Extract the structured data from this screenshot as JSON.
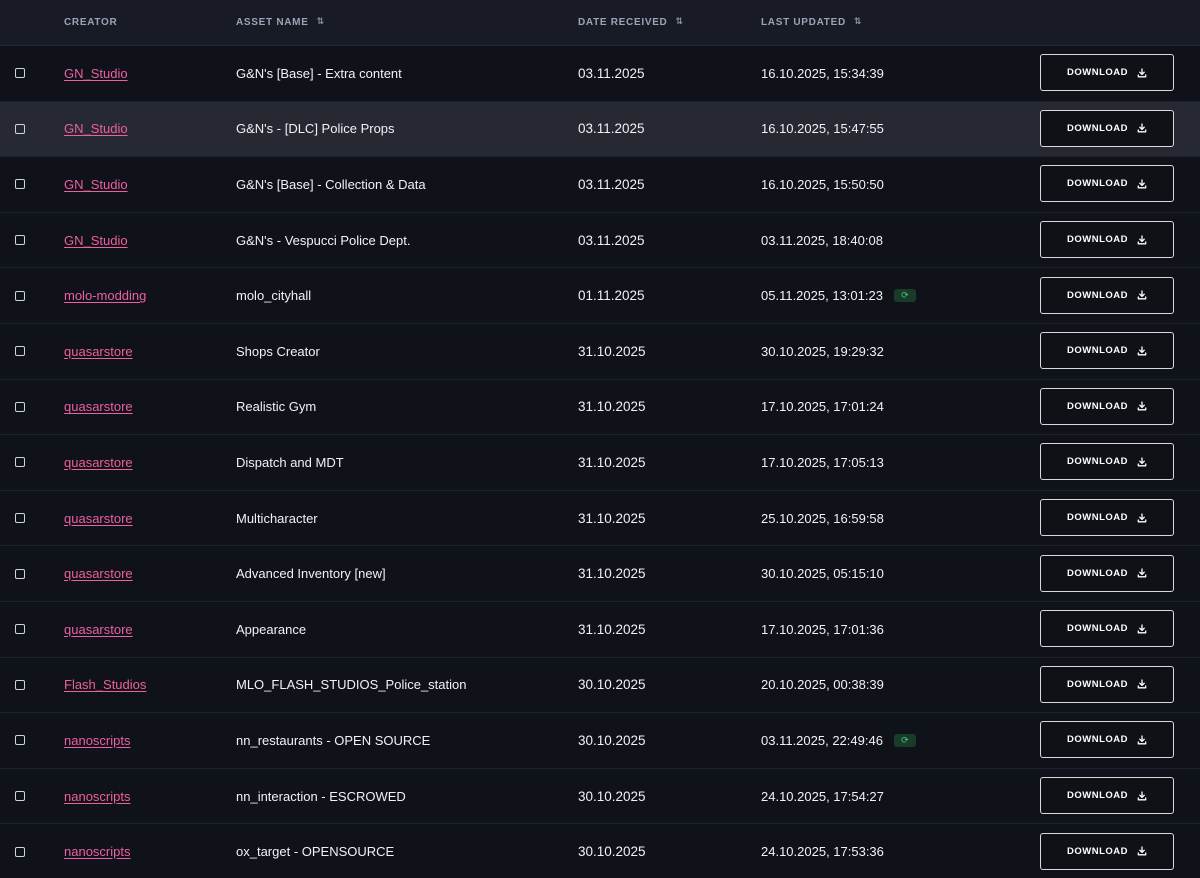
{
  "header": {
    "creator": "CREATOR",
    "asset_name": "ASSET NAME",
    "date_received": "DATE RECEIVED",
    "last_updated": "LAST UPDATED",
    "sort_glyph": "⇅"
  },
  "button": {
    "download_label": "DOWNLOAD"
  },
  "badge_glyph": "⟳",
  "colors": {
    "accent_link": "#ee5fa0",
    "badge_green": "#3ad07a"
  },
  "rows": [
    {
      "creator": "GN_Studio",
      "asset": "G&N's [Base] - Extra content",
      "received": "03.11.2025",
      "updated": "16.10.2025, 15:34:39",
      "badge": false
    },
    {
      "creator": "GN_Studio",
      "asset": "G&N's - [DLC] Police Props",
      "received": "03.11.2025",
      "updated": "16.10.2025, 15:47:55",
      "badge": false
    },
    {
      "creator": "GN_Studio",
      "asset": "G&N's [Base] - Collection & Data",
      "received": "03.11.2025",
      "updated": "16.10.2025, 15:50:50",
      "badge": false
    },
    {
      "creator": "GN_Studio",
      "asset": "G&N's - Vespucci Police Dept.",
      "received": "03.11.2025",
      "updated": "03.11.2025, 18:40:08",
      "badge": false
    },
    {
      "creator": "molo-modding",
      "asset": "molo_cityhall",
      "received": "01.11.2025",
      "updated": "05.11.2025, 13:01:23",
      "badge": true
    },
    {
      "creator": "quasarstore",
      "asset": "Shops Creator",
      "received": "31.10.2025",
      "updated": "30.10.2025, 19:29:32",
      "badge": false
    },
    {
      "creator": "quasarstore",
      "asset": "Realistic Gym",
      "received": "31.10.2025",
      "updated": "17.10.2025, 17:01:24",
      "badge": false
    },
    {
      "creator": "quasarstore",
      "asset": "Dispatch and MDT",
      "received": "31.10.2025",
      "updated": "17.10.2025, 17:05:13",
      "badge": false
    },
    {
      "creator": "quasarstore",
      "asset": "Multicharacter",
      "received": "31.10.2025",
      "updated": "25.10.2025, 16:59:58",
      "badge": false
    },
    {
      "creator": "quasarstore",
      "asset": "Advanced Inventory [new]",
      "received": "31.10.2025",
      "updated": "30.10.2025, 05:15:10",
      "badge": false
    },
    {
      "creator": "quasarstore",
      "asset": "Appearance",
      "received": "31.10.2025",
      "updated": "17.10.2025, 17:01:36",
      "badge": false
    },
    {
      "creator": "Flash_Studios",
      "asset": "MLO_FLASH_STUDIOS_Police_station",
      "received": "30.10.2025",
      "updated": "20.10.2025, 00:38:39",
      "badge": false
    },
    {
      "creator": "nanoscripts",
      "asset": "nn_restaurants - OPEN SOURCE",
      "received": "30.10.2025",
      "updated": "03.11.2025, 22:49:46",
      "badge": true
    },
    {
      "creator": "nanoscripts",
      "asset": "nn_interaction - ESCROWED",
      "received": "30.10.2025",
      "updated": "24.10.2025, 17:54:27",
      "badge": false
    },
    {
      "creator": "nanoscripts",
      "asset": "ox_target - OPENSOURCE",
      "received": "30.10.2025",
      "updated": "24.10.2025, 17:53:36",
      "badge": false
    }
  ]
}
